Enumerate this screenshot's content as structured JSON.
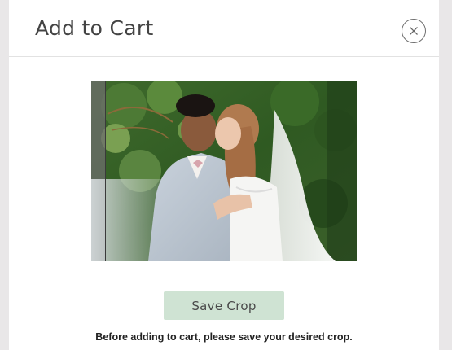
{
  "modal": {
    "title": "Add to Cart",
    "close_icon": "close-circle-x-icon"
  },
  "crop": {
    "image": "wedding-couple-photo"
  },
  "actions": {
    "save_crop_label": "Save Crop"
  },
  "instructions": {
    "text": "Before adding to cart, please save your desired crop."
  },
  "colors": {
    "save_button_bg": "#cfe3d3",
    "background": "#e9e7e8",
    "modal_bg": "#ffffff"
  }
}
